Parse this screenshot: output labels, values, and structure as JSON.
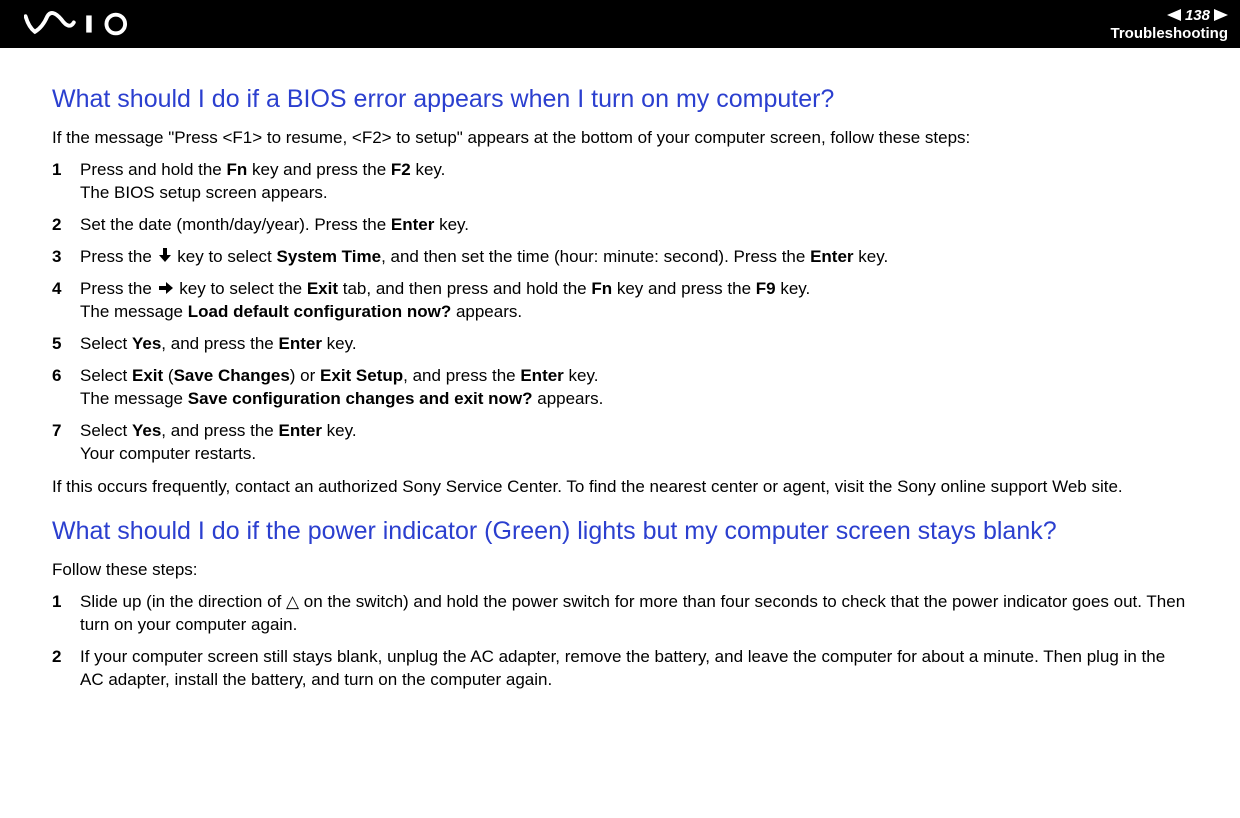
{
  "header": {
    "page_number": "138",
    "section_label": "Troubleshooting"
  },
  "section1": {
    "heading": "What should I do if a BIOS error appears when I turn on my computer?",
    "intro": "If the message \"Press <F1> to resume, <F2> to setup\" appears at the bottom of your computer screen, follow these steps:",
    "steps": [
      {
        "num": "1",
        "pre": "Press and hold the ",
        "b1": "Fn",
        "mid1": " key and press the ",
        "b2": "F2",
        "post": " key.",
        "line2": "The BIOS setup screen appears."
      },
      {
        "num": "2",
        "pre": "Set the date (month/day/year). Press the ",
        "b1": "Enter",
        "post": " key."
      },
      {
        "num": "3",
        "pre": "Press the ",
        "icon": "down",
        "mid1": " key to select ",
        "b1": "System Time",
        "mid2": ", and then set the time (hour: minute: second). Press the ",
        "b2": "Enter",
        "post": " key."
      },
      {
        "num": "4",
        "pre": "Press the ",
        "icon": "right",
        "mid1": " key to select the ",
        "b1": "Exit",
        "mid2": " tab, and then press and hold the ",
        "b2": "Fn",
        "mid3": " key and press the ",
        "b3": "F9",
        "post": " key.",
        "line2pre": "The message ",
        "line2b": "Load default configuration now?",
        "line2post": " appears."
      },
      {
        "num": "5",
        "pre": "Select ",
        "b1": "Yes",
        "mid1": ", and press the ",
        "b2": "Enter",
        "post": " key."
      },
      {
        "num": "6",
        "pre": "Select ",
        "b1": "Exit",
        "mid1": " (",
        "b2": "Save Changes",
        "mid2": ") or ",
        "b3": "Exit Setup",
        "mid3": ", and press the ",
        "b4": "Enter",
        "post": " key.",
        "line2pre": "The message ",
        "line2b": "Save configuration changes and exit now?",
        "line2post": " appears."
      },
      {
        "num": "7",
        "pre": "Select ",
        "b1": "Yes",
        "mid1": ", and press the ",
        "b2": "Enter",
        "post": " key.",
        "line2": "Your computer restarts."
      }
    ],
    "footer": "If this occurs frequently, contact an authorized Sony Service Center. To find the nearest center or agent, visit the Sony online support Web site."
  },
  "section2": {
    "heading": "What should I do if the power indicator (Green) lights but my computer screen stays blank?",
    "intro": "Follow these steps:",
    "steps": [
      {
        "num": "1",
        "text": "Slide up (in the direction of △ on the switch) and hold the power switch for more than four seconds to check that the power indicator goes out. Then turn on your computer again."
      },
      {
        "num": "2",
        "text": "If your computer screen still stays blank, unplug the AC adapter, remove the battery, and leave the computer for about a minute. Then plug in the AC adapter, install the battery, and turn on the computer again."
      }
    ]
  }
}
